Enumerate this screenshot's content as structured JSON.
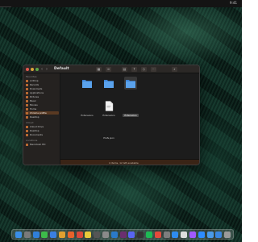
{
  "menubar": {
    "clock": "9:41"
  },
  "window": {
    "title": "Default",
    "nav": {
      "back": "‹",
      "forward": "›"
    },
    "toolbar_icons": [
      "view-grid-icon",
      "view-list-icon",
      "group-icon",
      "share-icon",
      "tag-icon",
      "more-icon",
      "search-icon"
    ]
  },
  "sidebar": {
    "groups": [
      {
        "title": "Favorites",
        "items": [
          {
            "label": "AirDrop",
            "icon": "airdrop-icon",
            "active": false
          },
          {
            "label": "Recents",
            "icon": "recents-icon",
            "active": false
          },
          {
            "label": "Downloads",
            "icon": "downloads-icon",
            "active": false
          },
          {
            "label": "Applications",
            "icon": "applications-icon",
            "active": false
          },
          {
            "label": "Pictures",
            "icon": "pictures-icon",
            "active": false
          },
          {
            "label": "Music",
            "icon": "music-icon",
            "active": false
          },
          {
            "label": "Movies",
            "icon": "movies-icon",
            "active": false
          },
          {
            "label": "Home",
            "icon": "home-icon",
            "active": false
          },
          {
            "label": "Chrome profile",
            "icon": "folder-icon",
            "active": true
          },
          {
            "label": "Desktop",
            "icon": "desktop-icon",
            "active": false
          }
        ]
      },
      {
        "title": "iCloud",
        "items": [
          {
            "label": "iCloud Drive",
            "icon": "icloud-icon",
            "active": false
          },
          {
            "label": "Desktop",
            "icon": "desktop-icon",
            "active": false
          },
          {
            "label": "Documents",
            "icon": "documents-icon",
            "active": false
          }
        ]
      },
      {
        "title": "Locations",
        "items": [
          {
            "label": "Macintosh HD",
            "icon": "disk-icon",
            "active": false
          }
        ]
      }
    ]
  },
  "files": [
    {
      "name": "Extensions",
      "type": "folder",
      "selected": false
    },
    {
      "name": "Extensions",
      "type": "folder",
      "selected": false
    },
    {
      "name": "Extensions",
      "type": "folder",
      "selected": true
    },
    {
      "name": "Prefs.json",
      "type": "file",
      "selected": false
    }
  ],
  "pathbar": {
    "status": "4 items, 12 GB available"
  },
  "dock": {
    "apps": [
      {
        "name": "finder-icon",
        "color": "#3a8ee6"
      },
      {
        "name": "launchpad-icon",
        "color": "#7a7a7a"
      },
      {
        "name": "safari-icon",
        "color": "#2f7fd8"
      },
      {
        "name": "messages-icon",
        "color": "#3dbb4a"
      },
      {
        "name": "mail-icon",
        "color": "#3a7fe0"
      },
      {
        "name": "photos-icon",
        "color": "#e0a030"
      },
      {
        "name": "firefox-icon",
        "color": "#e8622b"
      },
      {
        "name": "chrome-icon",
        "color": "#d9483b"
      },
      {
        "name": "notes-icon",
        "color": "#e8c83a"
      },
      {
        "name": "reminders-icon",
        "color": "#555555"
      },
      {
        "name": "tools-icon",
        "color": "#8a8a8a"
      },
      {
        "name": "vscode-icon",
        "color": "#2a7ac8"
      },
      {
        "name": "slack-icon",
        "color": "#6b2f6f"
      },
      {
        "name": "discord-icon",
        "color": "#5865f2"
      },
      {
        "name": "terminal-icon",
        "color": "#333333"
      },
      {
        "name": "spotify-icon",
        "color": "#1db954"
      },
      {
        "name": "calendar-icon",
        "color": "#e44a3c"
      },
      {
        "name": "preferences-icon",
        "color": "#7d7d7d"
      },
      {
        "name": "app-store-icon",
        "color": "#2e8cf0"
      },
      {
        "name": "notion-icon",
        "color": "#dddddd"
      },
      {
        "name": "figma-icon",
        "color": "#a259ff"
      },
      {
        "name": "zoom-icon",
        "color": "#2d8cff"
      },
      {
        "name": "folder-icon",
        "color": "#4a9ae8"
      },
      {
        "name": "downloads-icon",
        "color": "#3a86e0"
      },
      {
        "name": "trash-icon",
        "color": "#9a9a9a"
      }
    ]
  }
}
